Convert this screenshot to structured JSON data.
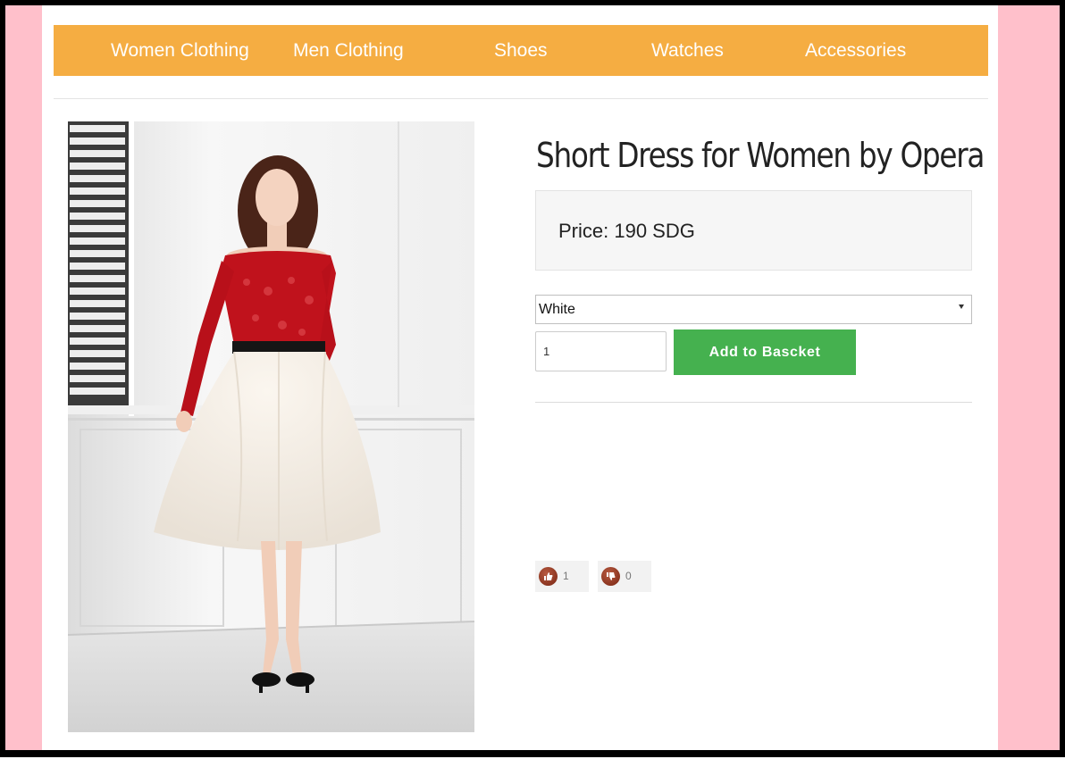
{
  "nav": {
    "items": [
      {
        "label": "Women Clothing"
      },
      {
        "label": "Men Clothing"
      },
      {
        "label": "Shoes"
      },
      {
        "label": "Watches"
      },
      {
        "label": "Accessories"
      }
    ]
  },
  "product": {
    "title": "Short Dress for Women by Opera",
    "price_text": "Price: 190 SDG",
    "image_icon": "product-photo-dress"
  },
  "options": {
    "color_value": "White",
    "quantity_value": "1",
    "add_button_label": "Add to Bascket"
  },
  "votes": {
    "likes": "1",
    "dislikes": "0",
    "like_icon": "thumbs-up-icon",
    "dislike_icon": "thumbs-down-icon"
  },
  "colors": {
    "nav_bg": "#f5ad42",
    "button_bg": "#45b14f",
    "side_bg": "#ffc0cb",
    "dress_top": "#c0121c"
  }
}
